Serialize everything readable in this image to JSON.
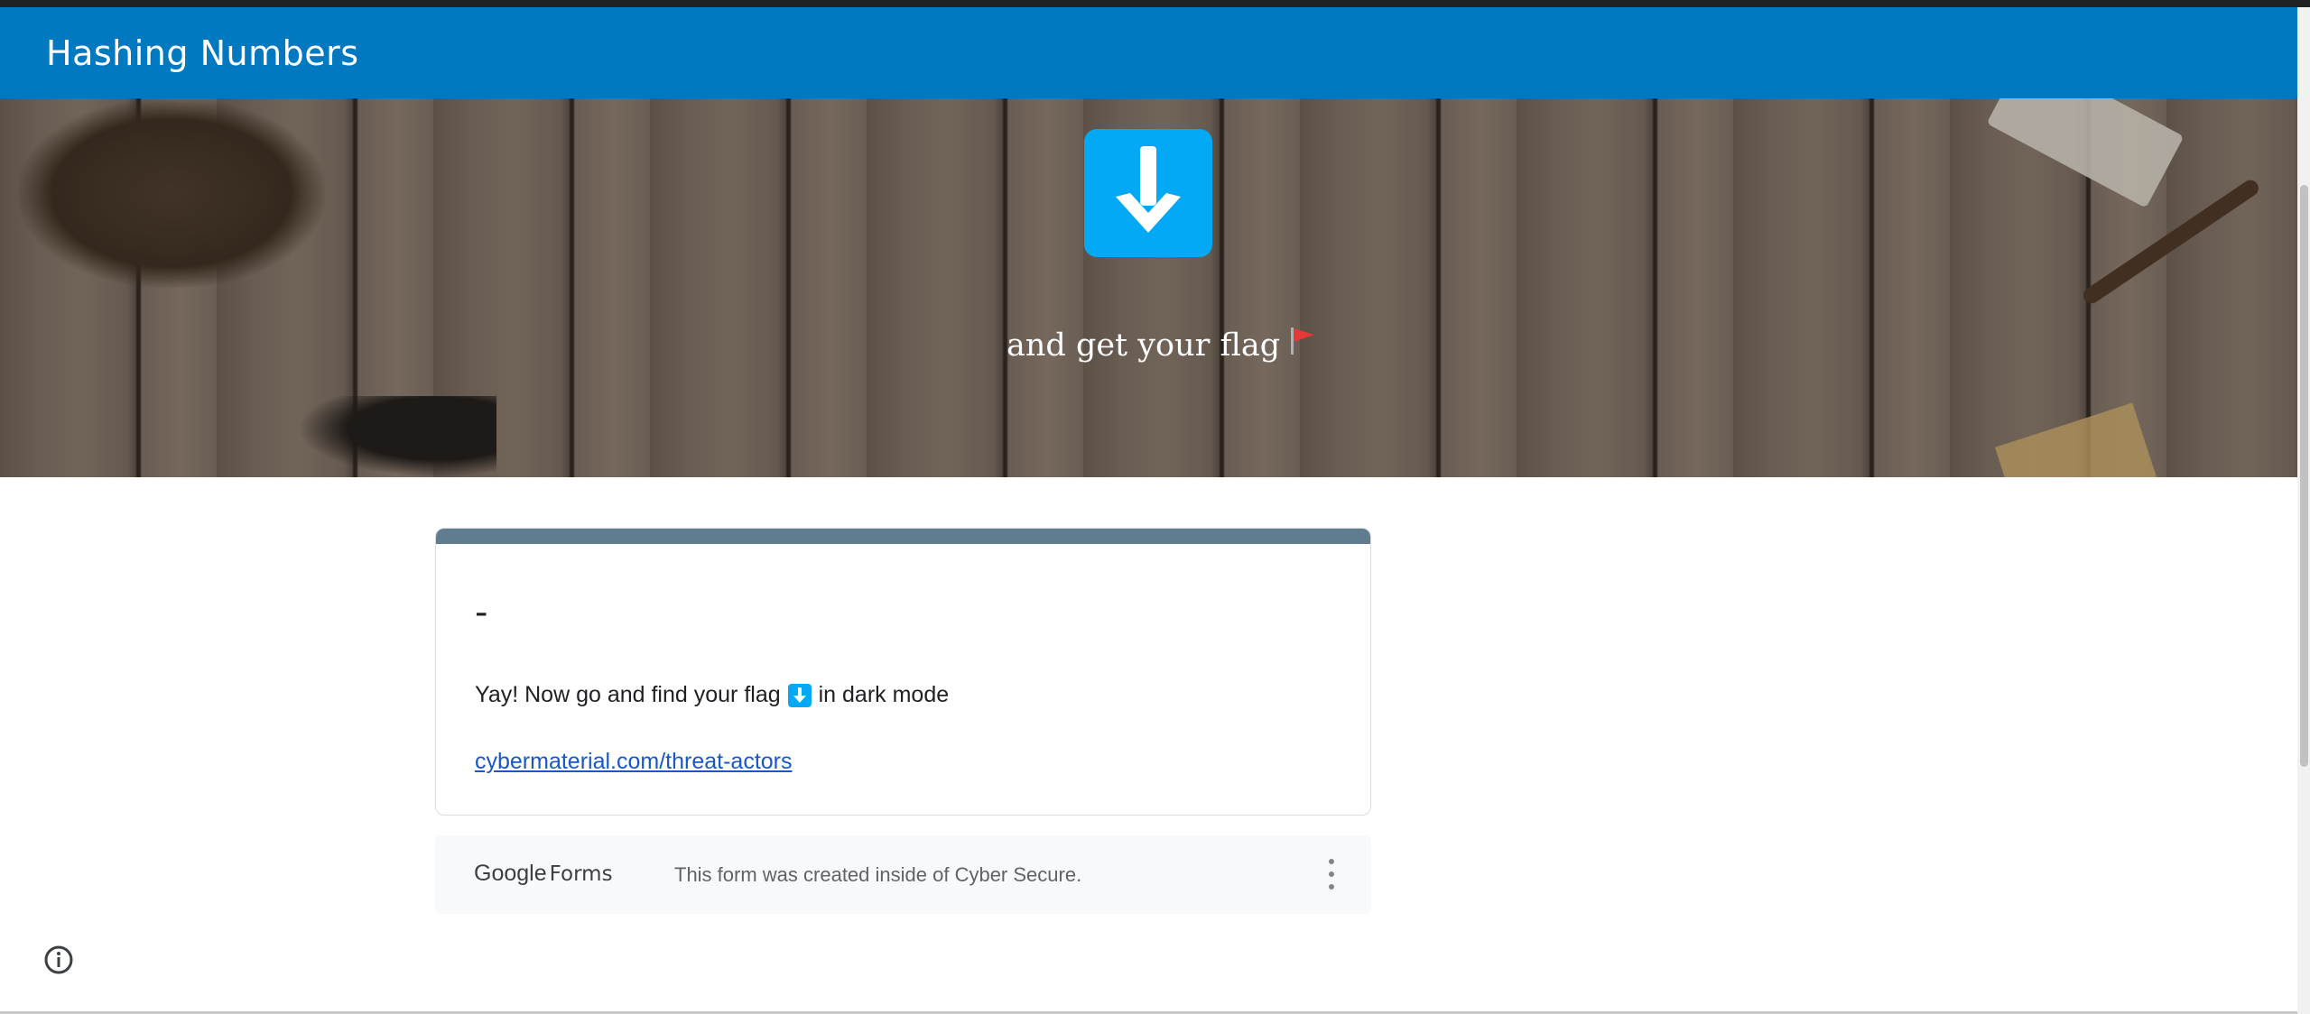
{
  "header": {
    "title": "Hashing Numbers"
  },
  "banner": {
    "tagline": "and get your flag",
    "tagline_icon": "red-flag-icon"
  },
  "card": {
    "heading": "-",
    "message_before": "Yay! Now go and find your flag",
    "message_icon": "down-arrow-icon",
    "message_after": "in dark mode",
    "link_text": "cybermaterial.com/threat-actors"
  },
  "footer": {
    "brand_google": "Google",
    "brand_forms": "Forms",
    "note": "This form was created inside of Cyber Secure."
  },
  "colors": {
    "header": "#0079c1",
    "accent": "#03a9f4",
    "card_bar": "#5f7d8e",
    "link": "#1a57c5",
    "flag": "#e53935"
  }
}
